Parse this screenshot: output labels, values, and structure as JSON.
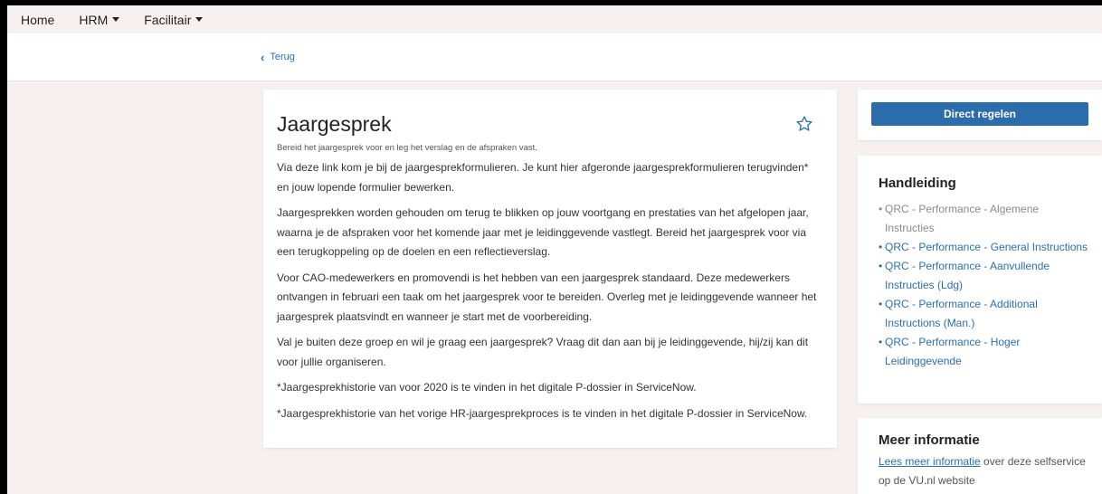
{
  "nav": {
    "items": [
      {
        "label": "Home",
        "dropdown": false
      },
      {
        "label": "HRM",
        "dropdown": true
      },
      {
        "label": "Facilitair",
        "dropdown": true
      }
    ]
  },
  "subnav": {
    "back_label": "Terug"
  },
  "main": {
    "title": "Jaargesprek",
    "subtitle": "Bereid het jaargesprek voor en leg het verslag en de afspraken vast.",
    "paragraphs": [
      "Via deze link kom je bij de jaargesprekformulieren. Je kunt hier afgeronde jaargesprekformulieren terugvinden* en jouw lopende formulier bewerken.",
      "Jaargesprekken worden gehouden om terug te blikken op jouw voortgang en prestaties van het afgelopen jaar, waarna je de afspraken voor het komende jaar met je leidinggevende vastlegt. Bereid het jaargesprek voor via een terugkoppeling op de doelen en een reflectieverslag.",
      "Voor CAO-medewerkers en promovendi is het hebben van een jaargesprek standaard. Deze medewerkers ontvangen in februari een taak om het jaargesprek voor te bereiden. Overleg met je leidinggevende wanneer het jaargesprek plaatsvindt en wanneer je start met de voorbereiding.",
      "Val je buiten deze groep en wil je graag een jaargesprek? Vraag dit dan aan bij je leidinggevende, hij/zij kan dit voor jullie organiseren.",
      "*Jaargesprekhistorie van voor 2020 is te vinden in het digitale P-dossier in ServiceNow.",
      "*Jaargesprekhistorie van het vorige HR-jaargesprekproces is te vinden in het digitale P-dossier in ServiceNow."
    ]
  },
  "sidebar": {
    "action_button": "Direct regelen",
    "manual": {
      "heading": "Handleiding",
      "items": [
        {
          "label": "QRC - Performance - Algemene Instructies"
        },
        {
          "label": "QRC - Performance - General Instructions"
        },
        {
          "label": "QRC - Performance - Aanvullende Instructies (Ldg)"
        },
        {
          "label": "QRC - Performance - Additional Instructions (Man.)"
        },
        {
          "label": "QRC - Performance - Hoger Leidinggevende"
        }
      ]
    },
    "info": {
      "heading": "Meer informatie",
      "link_text": "Lees meer informatie",
      "text_after": " over deze selfservice op de VU.nl website"
    }
  },
  "colors": {
    "background": "#f6f1f0",
    "primary_button": "#2b6cad",
    "link": "#2a6fb0",
    "muted_link": "#8a8a8a"
  },
  "icons": {
    "back": "chevron-left-icon",
    "favorite": "star-outline-icon",
    "dropdown": "caret-down-icon"
  }
}
